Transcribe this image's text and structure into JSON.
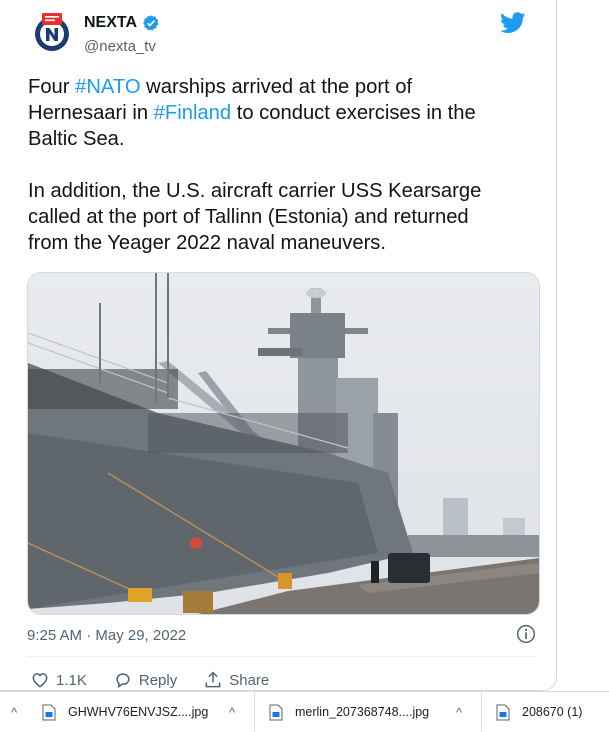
{
  "author": {
    "name": "NEXTA",
    "handle": "@nexta_tv"
  },
  "tweet": {
    "p1": [
      {
        "t": "Four "
      },
      {
        "t": "#NATO",
        "tag": true
      },
      {
        "t": " warships arrived at the port of\nHernesaari in "
      },
      {
        "t": "#Finland",
        "tag": true
      },
      {
        "t": " to conduct exercises in the\nBaltic Sea."
      }
    ],
    "p2": "In addition, the U.S. aircraft carrier USS Kearsarge\ncalled at the port of Tallinn (Estonia) and returned\nfrom the Yeager 2022 naval maneuvers.",
    "timestamp": "9:25 AM · May 29, 2022"
  },
  "actions": {
    "likes": "1.1K",
    "reply": "Reply",
    "share": "Share"
  },
  "downloads": [
    {
      "name": "GHWHV76ENVJSZ....jpg"
    },
    {
      "name": "merlin_207368748....jpg"
    },
    {
      "name": "208670 (1)"
    }
  ],
  "colors": {
    "accent": "#1d9bf0",
    "text": "#0f1419",
    "muted": "#536471"
  }
}
